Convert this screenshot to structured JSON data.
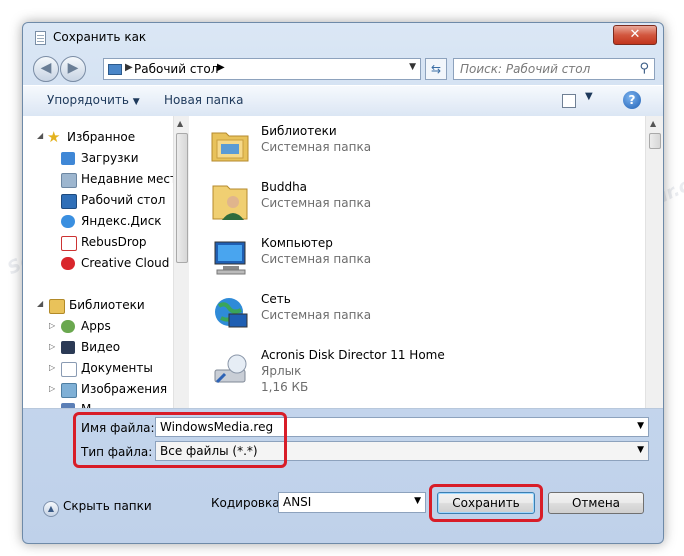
{
  "window": {
    "title": "Сохранить как",
    "close_label": "✕"
  },
  "nav": {
    "address": "Рабочий стол",
    "search_placeholder": "Поиск: Рабочий стол"
  },
  "toolbar": {
    "organize": "Упорядочить",
    "new_folder": "Новая папка",
    "help": "?"
  },
  "sidebar": {
    "items": [
      {
        "label": "Избранное",
        "icon": "star-icon"
      },
      {
        "label": "Загрузки",
        "icon": "downloads-icon"
      },
      {
        "label": "Недавние места",
        "icon": "recent-places-icon"
      },
      {
        "label": "Рабочий стол",
        "icon": "desktop-icon"
      },
      {
        "label": "Яндекс.Диск",
        "icon": "yandex-disk-icon"
      },
      {
        "label": "RebusDrop",
        "icon": "folder-icon"
      },
      {
        "label": "Creative Cloud Fi",
        "icon": "creative-cloud-icon"
      },
      {
        "label": "Библиотеки",
        "icon": "libraries-icon"
      },
      {
        "label": "Apps",
        "icon": "apps-icon"
      },
      {
        "label": "Видео",
        "icon": "video-icon"
      },
      {
        "label": "Документы",
        "icon": "documents-icon"
      },
      {
        "label": "Изображения",
        "icon": "images-icon"
      },
      {
        "label": "М",
        "icon": "music-icon"
      }
    ]
  },
  "files": [
    {
      "name": "Библиотеки",
      "type": "Системная папка",
      "icon": "libraries-folder-icon"
    },
    {
      "name": "Buddha",
      "type": "Системная папка",
      "icon": "user-folder-icon"
    },
    {
      "name": "Компьютер",
      "type": "Системная папка",
      "icon": "computer-icon"
    },
    {
      "name": "Сеть",
      "type": "Системная папка",
      "icon": "network-icon"
    },
    {
      "name": "Acronis Disk Director 11 Home",
      "type": "Ярлык",
      "size": "1,16 КБ",
      "icon": "shortcut-icon"
    }
  ],
  "form": {
    "filename_label": "Имя файла:",
    "filename_value": "WindowsMedia.reg",
    "filetype_label": "Тип файла:",
    "filetype_value": "Все файлы  (*.*)",
    "encoding_label": "Кодировка:",
    "encoding_value": "ANSI"
  },
  "footer": {
    "hide_folders": "Скрыть папки",
    "save": "Сохранить",
    "cancel": "Отмена"
  },
  "watermark": "Sovirgpscpair.com",
  "colors": {
    "highlight": "#d81d28",
    "accent": "#1e395b"
  }
}
